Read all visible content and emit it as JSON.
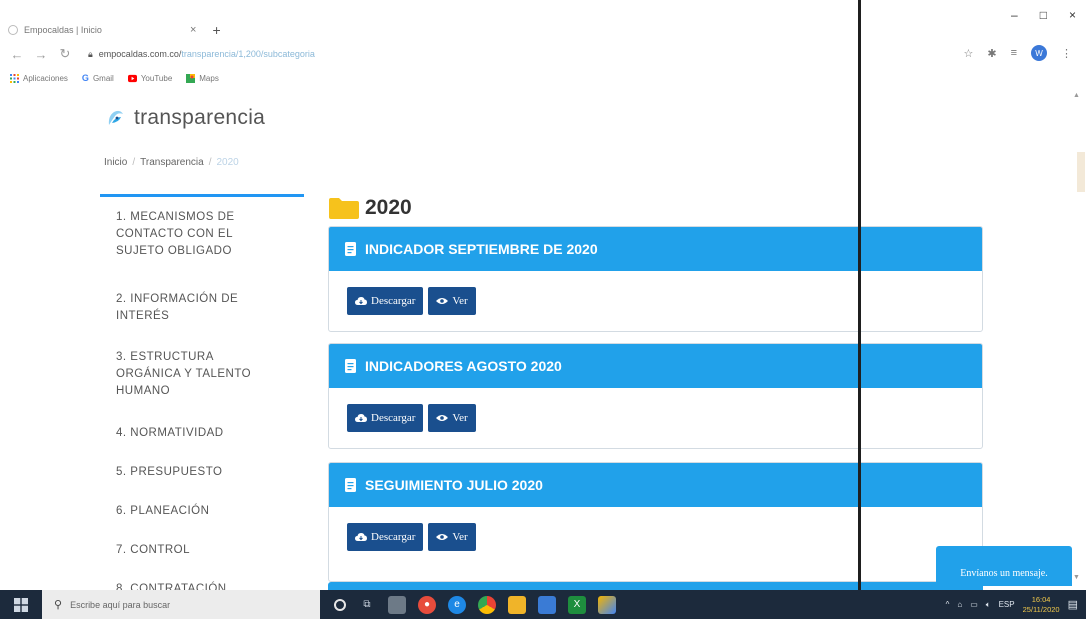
{
  "browser": {
    "tab_title": "Empocaldas | Inicio",
    "tab_close": "×",
    "new_tab": "+",
    "url_host": "empocaldas.com.co/",
    "url_path": "transparencia/1,200/subcategoria",
    "window_controls": [
      "–",
      "□",
      "×"
    ],
    "bookmarks": [
      {
        "label": "Aplicaciones",
        "icon": "apps-grid-icon",
        "color": "#4285f4"
      },
      {
        "label": "Gmail",
        "icon": "gmail-icon",
        "color": "#ea4335"
      },
      {
        "label": "YouTube",
        "icon": "youtube-icon",
        "color": "#ff0000"
      },
      {
        "label": "Maps",
        "icon": "maps-icon",
        "color": "#34a853"
      }
    ],
    "profile_initial": "W"
  },
  "header": {
    "brand": "transparencia"
  },
  "breadcrumb": {
    "home": "Inicio",
    "section": "Transparencia",
    "current": "2020",
    "separator": "/"
  },
  "sidebar": {
    "items": [
      {
        "label": "1. MECANISMOS DE CONTACTO CON EL SUJETO OBLIGADO"
      },
      {
        "label": "2. INFORMACIÓN DE INTERÉS"
      },
      {
        "label": "3. ESTRUCTURA ORGÁNICA Y TALENTO HUMANO"
      },
      {
        "label": "4. NORMATIVIDAD"
      },
      {
        "label": "5. PRESUPUESTO"
      },
      {
        "label": "6. PLANEACIÓN"
      },
      {
        "label": "7. CONTROL"
      },
      {
        "label": "8. CONTRATACIÓN"
      }
    ]
  },
  "main": {
    "folder_title": "2020",
    "documents": [
      {
        "title": "INDICADOR SEPTIEMBRE DE 2020",
        "download_label": "Descargar",
        "view_label": "Ver"
      },
      {
        "title": "INDICADORES AGOSTO 2020",
        "download_label": "Descargar",
        "view_label": "Ver"
      },
      {
        "title": "SEGUIMIENTO JULIO 2020",
        "download_label": "Descargar",
        "view_label": "Ver"
      }
    ]
  },
  "chat": {
    "label": "Envíanos un mensaje."
  },
  "taskbar": {
    "search_placeholder": "Escribe aquí para buscar",
    "language": "ESP",
    "time": "16:04",
    "date": "25/11/2020"
  },
  "colors": {
    "card_header": "#21a1ea",
    "button": "#1a4f8e",
    "sidebar_accent": "#2196f3",
    "folder": "#f6c21c",
    "taskbar": "#1c2a3c"
  }
}
